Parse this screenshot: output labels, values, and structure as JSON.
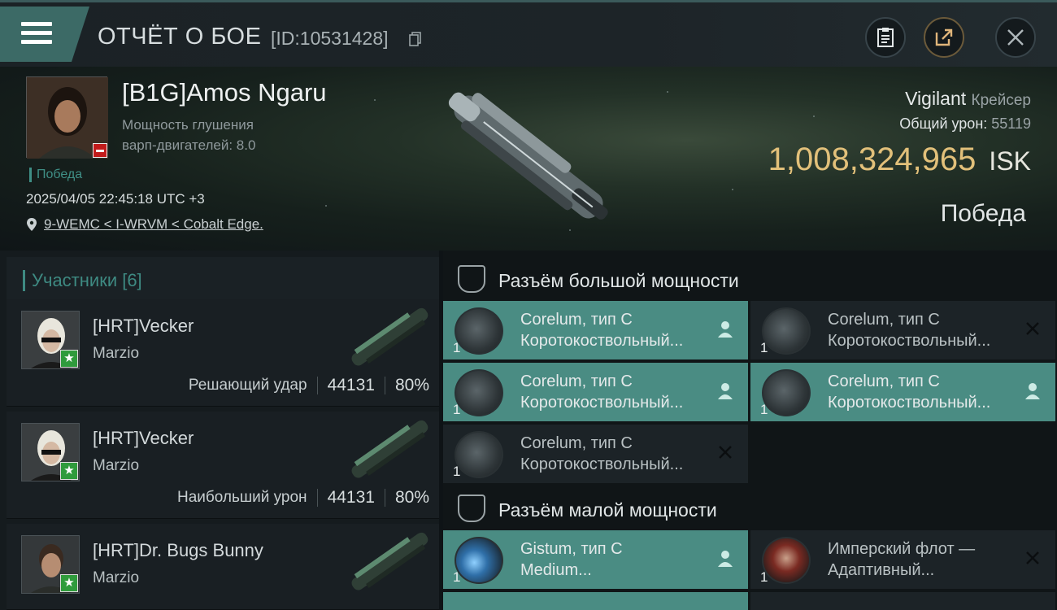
{
  "header": {
    "title": "ОТЧЁТ О БОЕ",
    "report_id": "[ID:10531428]"
  },
  "victim": {
    "name": "[B1G]Amos Ngaru",
    "jam_line1": "Мощность глушения",
    "jam_line2": "варп-двигателей: 8.0",
    "win_tag": "Победа",
    "datetime": "2025/04/05 22:45:18 UTC +3",
    "location": "9-WEMC < I-WRVM < Cobalt Edge."
  },
  "ship": {
    "name": "Vigilant",
    "class": "Крейсер",
    "damage_label": "Общий урон:",
    "damage_value": "55119",
    "isk_value": "1,008,324,965",
    "isk_unit": "ISK",
    "result": "Победа"
  },
  "participants": {
    "title": "Участники [6]",
    "rows": [
      {
        "name": "[HRT]Vecker",
        "corp": "Marzio",
        "label": "Решающий удар",
        "damage": "44131",
        "percent": "80%"
      },
      {
        "name": "[HRT]Vecker",
        "corp": "Marzio",
        "label": "Наибольший урон",
        "damage": "44131",
        "percent": "80%"
      },
      {
        "name": "[HRT]Dr. Bugs Bunny",
        "corp": "Marzio",
        "label": "",
        "damage": "",
        "percent": ""
      }
    ]
  },
  "fitting": {
    "high_title": "Разъём большой мощности",
    "low_title": "Разъём малой мощности",
    "high_slots": [
      {
        "qty": "1",
        "line1": "Corelum, тип C",
        "line2": "Коротокоствольный...",
        "state": "active",
        "mark": "user-icon"
      },
      {
        "qty": "1",
        "line1": "Corelum, тип C",
        "line2": "Коротокоствольный...",
        "state": "inactive",
        "mark": "close-icon"
      },
      {
        "qty": "1",
        "line1": "Corelum, тип C",
        "line2": "Коротокоствольный...",
        "state": "active",
        "mark": "user-icon"
      },
      {
        "qty": "1",
        "line1": "Corelum, тип C",
        "line2": "Коротокоствольный...",
        "state": "active",
        "mark": "user-icon"
      },
      {
        "qty": "1",
        "line1": "Corelum, тип C",
        "line2": "Коротокоствольный...",
        "state": "inactive",
        "mark": "close-icon"
      }
    ],
    "low_slots": [
      {
        "qty": "1",
        "line1": "Gistum, тип C",
        "line2": "Medium...",
        "state": "active",
        "mark": "user-icon"
      },
      {
        "qty": "1",
        "line1": "Имперский флот —",
        "line2": "Адаптивный...",
        "state": "inactive",
        "mark": "close-icon"
      }
    ]
  },
  "colors": {
    "accent": "#4a8c83",
    "isk": "#e2c07a",
    "win": "#3f8f86",
    "badge_red": "#c21b1b",
    "badge_green": "#2f9b3c"
  }
}
